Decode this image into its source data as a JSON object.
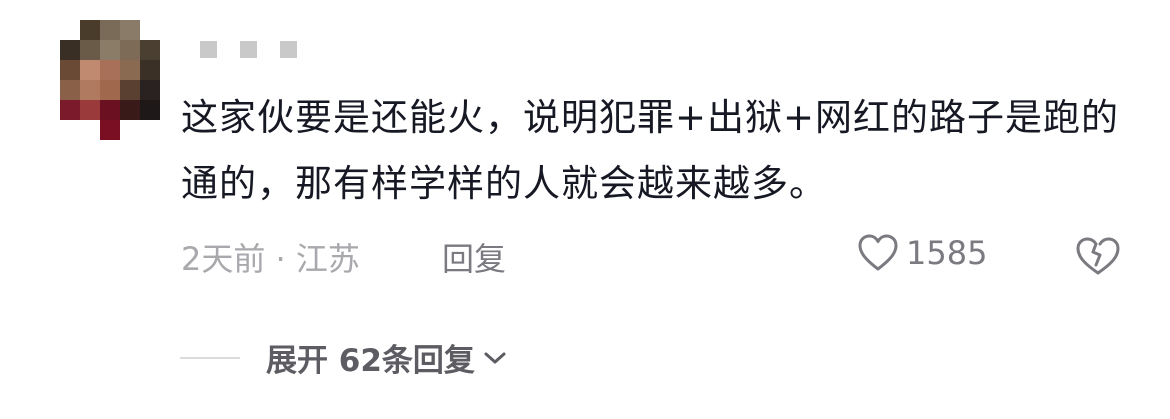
{
  "comment": {
    "text": "这家伙要是还能火，说明犯罪+出狱+网红的路子是跑的通的，那有样学样的人就会越来越多。",
    "time": "2天前",
    "separator": " · ",
    "location": "江苏",
    "reply_label": "回复",
    "like_count": "1585"
  },
  "expand": {
    "label": "展开 62条回复"
  },
  "icons": {
    "like": "heart-outline-icon",
    "dislike": "broken-heart-icon",
    "expand": "chevron-down-icon"
  }
}
